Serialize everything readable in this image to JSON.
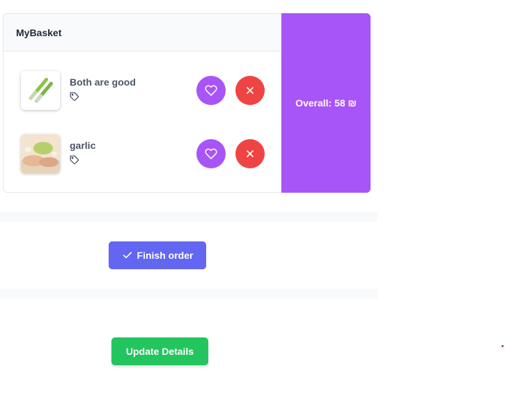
{
  "basket": {
    "title": "MyBasket",
    "items": [
      {
        "name": "Both are good",
        "image": "peeler-product-image"
      },
      {
        "name": "garlic",
        "image": "garlic-peeler-image"
      }
    ],
    "favorite_icon": "heart-icon",
    "remove_icon": "close-icon",
    "tag_icon": "tag-icon"
  },
  "overall": {
    "label": "Overall: 58 ₪"
  },
  "actions": {
    "finish_label": "Finish order",
    "update_label": "Update Details"
  },
  "colors": {
    "purple": "#a855f7",
    "red": "#ef4444",
    "indigo": "#6366f1",
    "green": "#22c55e"
  }
}
